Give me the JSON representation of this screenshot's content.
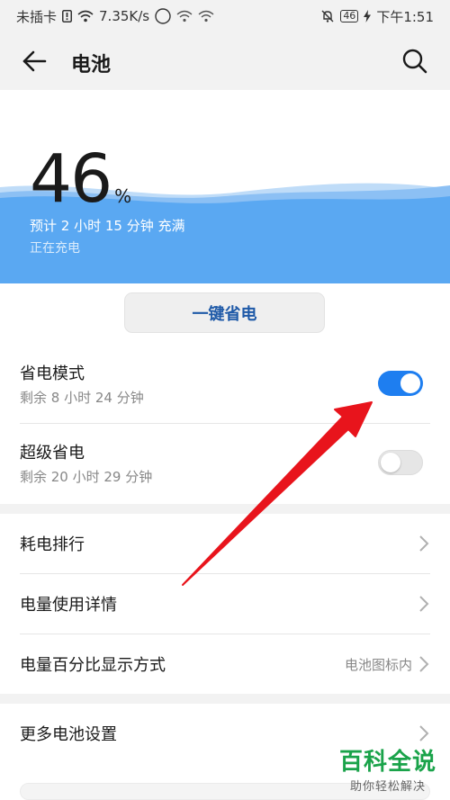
{
  "status_bar": {
    "sim_text": "未插卡",
    "speed": "7.35K/s",
    "net_badge": "46",
    "battery": "46",
    "time": "下午1:51"
  },
  "header": {
    "title": "电池"
  },
  "hero": {
    "percent": "46",
    "percent_sign": "%",
    "eta": "预计 2 小时 15 分钟 充满",
    "status": "正在充电"
  },
  "actions": {
    "one_key_label": "一键省电"
  },
  "power_modes": [
    {
      "title": "省电模式",
      "subtitle": "剩余 8 小时 24 分钟",
      "enabled": true
    },
    {
      "title": "超级省电",
      "subtitle": "剩余 20 小时 29 分钟",
      "enabled": false
    }
  ],
  "list": {
    "ranking": "耗电排行",
    "usage_detail": "电量使用详情",
    "percent_display": "电量百分比显示方式",
    "percent_display_value": "电池图标内",
    "more_settings": "更多电池设置"
  },
  "watermark": {
    "title": "百科全说",
    "subtitle": "助你轻松解决"
  },
  "colors": {
    "accent": "#1e7ef0",
    "hero_blue": "#5aa8f2",
    "annotation_arrow": "#e8141c",
    "watermark_green": "#1aa34a"
  }
}
